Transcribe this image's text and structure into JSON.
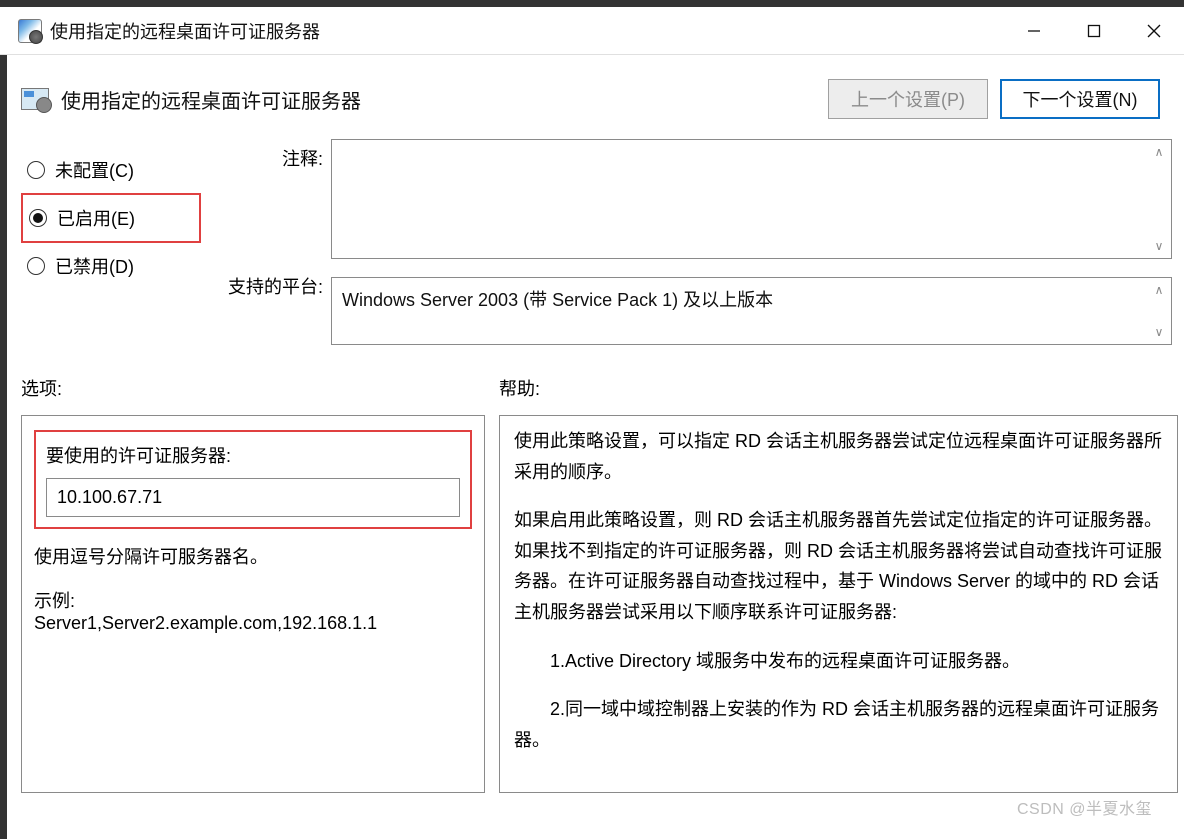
{
  "window": {
    "title": "使用指定的远程桌面许可证服务器"
  },
  "header": {
    "policy_title": "使用指定的远程桌面许可证服务器",
    "prev_button": "上一个设置(P)",
    "next_button": "下一个设置(N)"
  },
  "radios": {
    "not_configured": "未配置(C)",
    "enabled": "已启用(E)",
    "disabled": "已禁用(D)",
    "selected": "enabled"
  },
  "labels": {
    "comment": "注释:",
    "supported": "支持的平台:",
    "options": "选项:",
    "help": "帮助:"
  },
  "fields": {
    "comment_value": "",
    "supported_value": "Windows Server 2003 (带 Service Pack 1) 及以上版本"
  },
  "options": {
    "servers_label": "要使用的许可证服务器:",
    "servers_value": "10.100.67.71",
    "hint": "使用逗号分隔许可服务器名。",
    "example_label": "示例:",
    "example_value": "Server1,Server2.example.com,192.168.1.1"
  },
  "help": {
    "p1": "使用此策略设置，可以指定 RD 会话主机服务器尝试定位远程桌面许可证服务器所采用的顺序。",
    "p2": "如果启用此策略设置，则 RD 会话主机服务器首先尝试定位指定的许可证服务器。如果找不到指定的许可证服务器，则 RD 会话主机服务器将尝试自动查找许可证服务器。在许可证服务器自动查找过程中，基于 Windows Server 的域中的 RD 会话主机服务器尝试采用以下顺序联系许可证服务器:",
    "li1": "1.Active Directory 域服务中发布的远程桌面许可证服务器。",
    "li2": "2.同一域中域控制器上安装的作为 RD 会话主机服务器的远程桌面许可证服务器。"
  },
  "watermark": "CSDN @半夏水玺"
}
